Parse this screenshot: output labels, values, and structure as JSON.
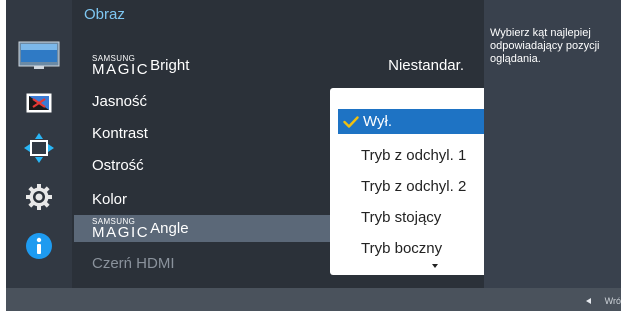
{
  "menu": {
    "title": "Obraz",
    "items": [
      {
        "brand_small": "SAMSUNG",
        "brand_big": "MAGIC",
        "label": "Bright",
        "value": "Niestandar."
      },
      {
        "label": "Jasność"
      },
      {
        "label": "Kontrast"
      },
      {
        "label": "Ostrość"
      },
      {
        "label": "Kolor"
      },
      {
        "brand_small": "SAMSUNG",
        "brand_big": "MAGIC",
        "label": "Angle",
        "state": "selected"
      },
      {
        "label": "Czerń HDMI",
        "state": "disabled"
      }
    ]
  },
  "submenu": {
    "selected_index": 0,
    "options": [
      "Wył.",
      "Tryb z odchyl. 1",
      "Tryb z odchyl. 2",
      "Tryb stojący",
      "Tryb boczny"
    ]
  },
  "help": {
    "text": "Wybierz kąt najlepiej odpowiadający pozycji oglądania."
  },
  "sidebar_icons": [
    "picture-icon",
    "color-box-icon",
    "screen-size-icon",
    "gear-icon",
    "info-icon"
  ],
  "footer": {
    "back_label": "Wró"
  },
  "colors": {
    "accent": "#1e73c4",
    "title": "#7ec7f2",
    "check": "#f0c010"
  }
}
